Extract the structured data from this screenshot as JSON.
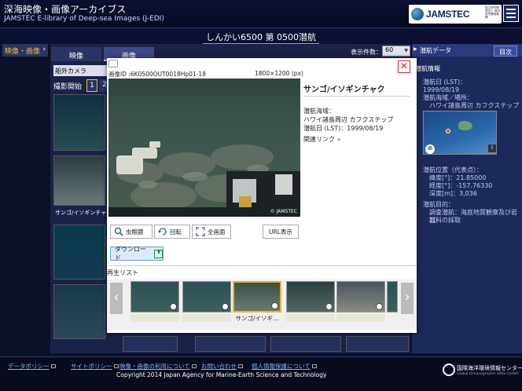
{
  "header": {
    "title": "深海映像・画像アーカイブス",
    "subtitle": "JAMSTEC E-library of Deep-sea Images (J-EDI)",
    "logo_text": "JAMSTEC",
    "logo_jp": "国立研究開発法人 海洋研究開発機構"
  },
  "dive_title": "しんかい6500 第 0500潜航",
  "section_tab": {
    "label": "映像・画像",
    "chevron": "›"
  },
  "main": {
    "tabs": [
      {
        "label": "映像"
      },
      {
        "label": "画像"
      }
    ],
    "count_label": "表示件数：",
    "count_value": "60",
    "camera": "船外カメラ",
    "shoot_start": "撮影開始",
    "pages": [
      "1",
      "2"
    ],
    "thumb_label": "サンゴ/イソギンチャク"
  },
  "right_panel": {
    "header": "潜航データ",
    "toc_button": "目次",
    "info_header": "潜航情報",
    "dive_date_label": "潜航日 (LST)：",
    "dive_date": "1999/08/19",
    "area_label": "潜航海域／場所：",
    "area_value": "ハワイ諸島周辺 カフクステップ",
    "pos_label": "潜航位置（代表点）：",
    "lat": "緯度[°]：21.85000",
    "lon": "経度[°]：-157.76330",
    "depth": "深度[m]：3,036",
    "purpose_label": "潜航目的：",
    "purpose_1": "調査潜航：海底地質観察及び岩石",
    "purpose_2": "試料の採取"
  },
  "modal": {
    "close": "✕",
    "image_id": "画像ID :6K0500OUT0018Hp01-18",
    "image_size": "1800×1200 (px)",
    "watermark": "© JAMSTEC",
    "species_title": "サンゴ/イソギンチャク",
    "area_label": "潜航海域：",
    "area_value": "ハワイ諸島周辺 カフクステップ",
    "date_line": "潜航日 (LST)：1999/08/19",
    "related_link": "関連リンク",
    "related_chev": "»",
    "btn_magnifier": "虫眼鏡",
    "btn_rotate": "回転",
    "btn_fullscreen": "全画面",
    "btn_url": "URL表示",
    "download": "ダウンロード",
    "playlist_label": "再生リスト",
    "strip_caption": "サンゴ/イソギ…",
    "strip_prev": "‹",
    "strip_next": "›"
  },
  "footer": {
    "links": [
      "データポリシー",
      "サイトポリシー",
      "映像・画像の利用について",
      "お問い合わせ",
      "個人情報保護について"
    ],
    "copyright": "Copyright 2014 Japan Agency for Marine-Earth Science and Technology",
    "gcdc_name": "国際海洋環境情報センター",
    "gcdc_en": "Global Oceanographic DAta Center"
  },
  "colors": {
    "background": "#0b1026",
    "accent_gold": "#c89d2a",
    "close_red": "#d22233",
    "link_blue": "#7eb0ff"
  }
}
